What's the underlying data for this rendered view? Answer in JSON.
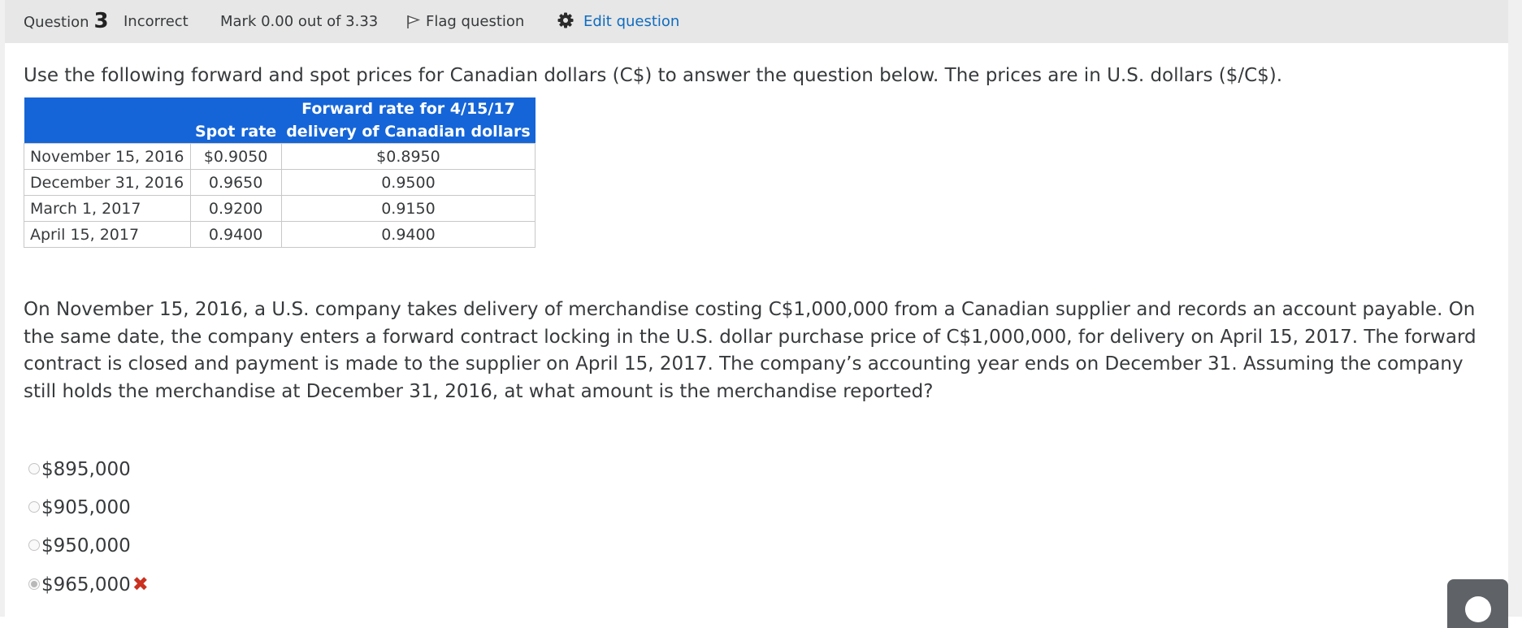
{
  "header": {
    "question_label": "Question",
    "question_number": "3",
    "state": "Incorrect",
    "mark": "Mark 0.00 out of 3.33",
    "flag_label": "Flag question",
    "edit_label": "Edit question"
  },
  "question": {
    "intro": "Use the following forward and spot prices for Canadian dollars (C$) to answer the question below. The prices are in U.S. dollars ($/C$).",
    "table": {
      "header_forward_line1": "Forward rate for 4/15/17",
      "header_spot": "Spot rate",
      "header_forward_line2": "delivery of Canadian dollars",
      "rows": [
        {
          "date": "November 15, 2016",
          "spot": "$0.9050",
          "forward": "$0.8950"
        },
        {
          "date": "December 31, 2016",
          "spot": "0.9650",
          "forward": "0.9500"
        },
        {
          "date": "March 1, 2017",
          "spot": "0.9200",
          "forward": "0.9150"
        },
        {
          "date": "April 15, 2017",
          "spot": "0.9400",
          "forward": "0.9400"
        }
      ]
    },
    "text": "On November 15, 2016, a U.S. company takes delivery of merchandise costing C$1,000,000 from a Canadian supplier and records an account payable. On the same date, the company enters a forward contract locking in the U.S. dollar purchase price of C$1,000,000, for delivery on April 15, 2017. The forward contract is closed and payment is made to the supplier on April 15, 2017. The company’s accounting year ends on December 31. Assuming the company still holds the merchandise at December 31, 2016, at what amount is the merchandise reported?",
    "answers": [
      {
        "label": "$895,000",
        "selected": false
      },
      {
        "label": "$905,000",
        "selected": false
      },
      {
        "label": "$950,000",
        "selected": false
      },
      {
        "label": "$965,000",
        "selected": true,
        "incorrect_mark": "✖"
      }
    ]
  },
  "colors": {
    "header_bg": "#e7e7e7",
    "table_header_bg": "#1565d8",
    "link": "#0f6cbf",
    "incorrect": "#ca3120",
    "scroll_button_bg": "#5f6368"
  },
  "icons": {
    "flag": "flag-icon",
    "edit": "gear-icon",
    "incorrect": "cross-icon",
    "scroll_top": "arrow-up-circle-icon"
  }
}
